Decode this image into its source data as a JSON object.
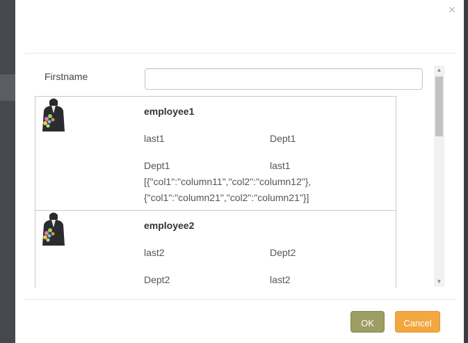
{
  "dialog": {
    "close_glyph": "×"
  },
  "form": {
    "firstname_label": "Firstname",
    "firstname_value": "",
    "firstname_placeholder": ""
  },
  "employees": [
    {
      "name": "employee1",
      "row1_left": "last1",
      "row1_right": "Dept1",
      "row2_left": "Dept1",
      "row2_right": "last1",
      "json_line1": "[{\"col1\":\"column11\",\"col2\":\"column12\"},",
      "json_line2": "{\"col1\":\"column21\",\"col2\":\"column21\"}]",
      "avatar_icon": "employee-photo"
    },
    {
      "name": "employee2",
      "row1_left": "last2",
      "row1_right": "Dept2",
      "row2_left": "Dept2",
      "row2_right": "last2",
      "avatar_icon": "employee-photo"
    }
  ],
  "footer": {
    "ok_label": "OK",
    "cancel_label": "Cancel"
  },
  "colors": {
    "ok_button": "#9c9e63",
    "cancel_button": "#f3a740",
    "backdrop": "#3e4247"
  }
}
